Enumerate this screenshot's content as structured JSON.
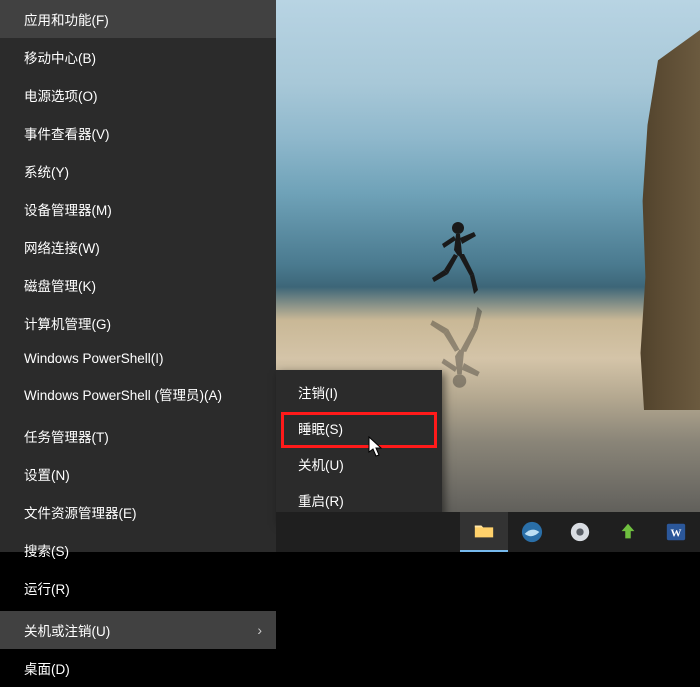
{
  "winx_menu": {
    "items": [
      {
        "label": "应用和功能(F)"
      },
      {
        "label": "移动中心(B)"
      },
      {
        "label": "电源选项(O)"
      },
      {
        "label": "事件查看器(V)"
      },
      {
        "label": "系统(Y)"
      },
      {
        "label": "设备管理器(M)"
      },
      {
        "label": "网络连接(W)"
      },
      {
        "label": "磁盘管理(K)"
      },
      {
        "label": "计算机管理(G)"
      },
      {
        "label": "Windows PowerShell(I)"
      },
      {
        "label": "Windows PowerShell (管理员)(A)"
      }
    ],
    "items2": [
      {
        "label": "任务管理器(T)"
      },
      {
        "label": "设置(N)"
      },
      {
        "label": "文件资源管理器(E)"
      },
      {
        "label": "搜索(S)"
      },
      {
        "label": "运行(R)"
      }
    ],
    "items3": [
      {
        "label": "关机或注销(U)",
        "has_submenu": true,
        "hovered": true
      },
      {
        "label": "桌面(D)"
      }
    ]
  },
  "power_submenu": {
    "items": [
      {
        "label": "注销(I)"
      },
      {
        "label": "睡眠(S)",
        "highlighted": true
      },
      {
        "label": "关机(U)"
      },
      {
        "label": "重启(R)"
      }
    ]
  },
  "taskbar": {
    "icons": [
      {
        "name": "file-explorer-icon"
      },
      {
        "name": "swirl-app-icon"
      },
      {
        "name": "settings-gear-icon"
      },
      {
        "name": "upload-arrow-icon"
      },
      {
        "name": "word-app-icon"
      }
    ]
  }
}
